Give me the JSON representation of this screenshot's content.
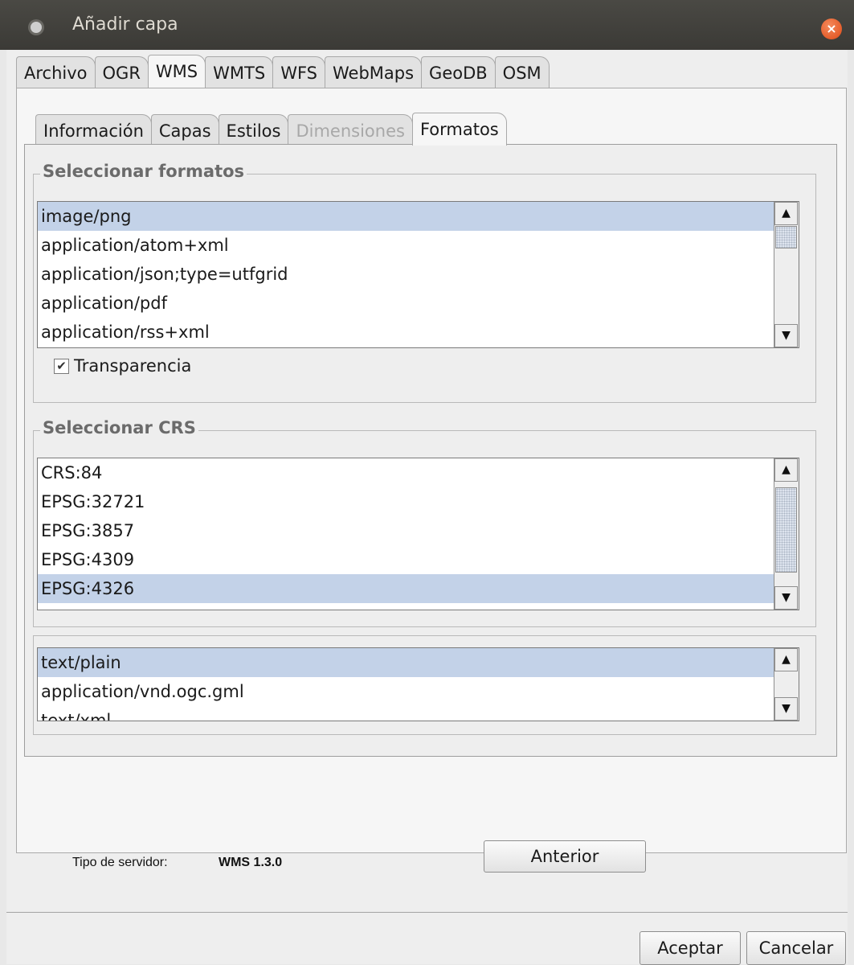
{
  "window": {
    "title": "Añadir capa",
    "close_glyph": "×"
  },
  "top_tabs": [
    "Archivo",
    "OGR",
    "WMS",
    "WMTS",
    "WFS",
    "WebMaps",
    "GeoDB",
    "OSM"
  ],
  "top_tab_selected": "WMS",
  "inner_tabs": [
    "Información",
    "Capas",
    "Estilos",
    "Dimensiones",
    "Formatos"
  ],
  "inner_tab_selected": "Formatos",
  "inner_tab_disabled": "Dimensiones",
  "formats": {
    "title": "Seleccionar formatos",
    "items": [
      "image/png",
      "application/atom+xml",
      "application/json;type=utfgrid",
      "application/pdf",
      "application/rss+xml"
    ],
    "selected": "image/png",
    "transparency_label": "Transparencia",
    "transparency_checked": true
  },
  "crs": {
    "title": "Seleccionar CRS",
    "items": [
      "CRS:84",
      "EPSG:32721",
      "EPSG:3857",
      "EPSG:4309",
      "EPSG:4326"
    ],
    "selected": "EPSG:4326"
  },
  "info_formats": {
    "items": [
      "text/plain",
      "application/vnd.ogc.gml",
      "text/xml"
    ],
    "selected": "text/plain"
  },
  "server": {
    "label": "Tipo de servidor:",
    "value": "WMS 1.3.0"
  },
  "buttons": {
    "previous": "Anterior",
    "accept": "Aceptar",
    "cancel": "Cancelar"
  },
  "icons": {
    "scroll_up": "▲",
    "scroll_down": "▼",
    "check": "✔"
  }
}
